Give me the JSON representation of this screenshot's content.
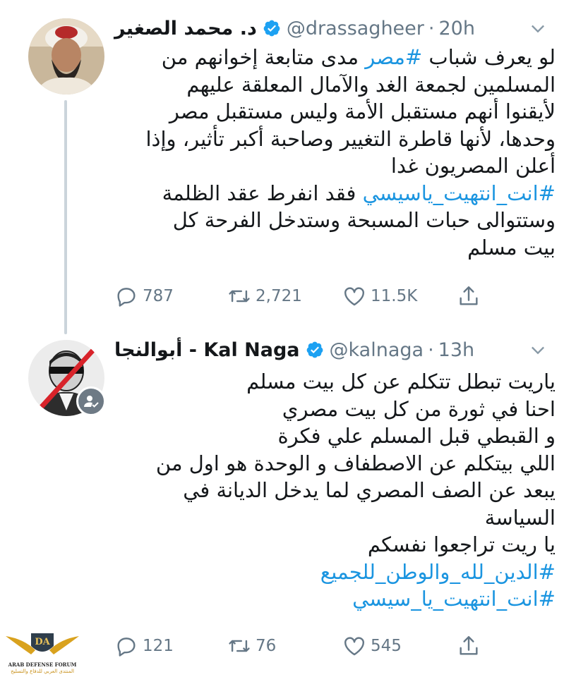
{
  "tweets": [
    {
      "name": "د. محمد الصغير",
      "handle": "@drassagheer",
      "separator": "·",
      "time": "20h",
      "body_lines": [
        [
          {
            "t": "لو يعرف شباب "
          },
          {
            "t": "#مصر",
            "tag": true
          },
          {
            "t": " مدى متابعة إخوانهم من"
          }
        ],
        [
          {
            "t": "المسلمين لجمعة الغد والآمال المعلقة عليهم"
          }
        ],
        [
          {
            "t": "لأيقنوا أنهم مستقبل الأمة وليس مستقبل مصر"
          }
        ],
        [
          {
            "t": "وحدها، لأنها قاطرة التغيير وصاحبة أكبر تأثير، وإذا"
          }
        ],
        [
          {
            "t": "أعلن المصريون غدا"
          }
        ],
        [
          {
            "t": "#انت_انتهيت_ياسيسي",
            "tag": true
          },
          {
            "t": " فقد انفرط عقد الظلمة"
          }
        ],
        [
          {
            "t": "وستتوالى حبات المسبحة وستدخل الفرحة كل"
          }
        ],
        [
          {
            "t": "بيت مسلم"
          }
        ]
      ],
      "replies": "787",
      "retweets": "2,721",
      "likes": "11.5K"
    },
    {
      "name": "أبوالنجا - Kal Naga",
      "handle": "@kalnaga",
      "separator": "·",
      "time": "13h",
      "body_lines": [
        [
          {
            "t": "ياريت تبطل تتكلم عن كل بيت مسلم"
          }
        ],
        [
          {
            "t": "احنا في ثورة من كل بيت مصري"
          }
        ],
        [
          {
            "t": "و القبطي قبل المسلم علي فكرة"
          }
        ],
        [
          {
            "t": "اللي بيتكلم عن الاصطفاف و الوحدة هو اول من"
          }
        ],
        [
          {
            "t": "يبعد عن الصف المصري لما يدخل الديانة في"
          }
        ],
        [
          {
            "t": "السياسة"
          }
        ],
        [
          {
            "t": "يا ريت تراجعوا نفسكم"
          }
        ],
        [
          {
            "t": "#الدين_لله_والوطن_للجميع",
            "tag": true
          }
        ],
        [
          {
            "t": "#انت_انتهيت_يا_سيسي",
            "tag": true
          }
        ]
      ],
      "replies": "121",
      "retweets": "76",
      "likes": "545"
    }
  ],
  "watermark": {
    "letters": "DA",
    "title": "ARAB DEFENSE FORUM",
    "subtitle": "المنتدى العربي للدفاع والتسليح"
  },
  "colors": {
    "link": "#1b95e0",
    "muted": "#657786",
    "verified": "#1da1f2",
    "text": "#14171a"
  },
  "icons": [
    "verified-badge-icon",
    "chevron-down-icon",
    "reply-icon",
    "retweet-icon",
    "like-icon",
    "share-icon",
    "dm-icon"
  ]
}
